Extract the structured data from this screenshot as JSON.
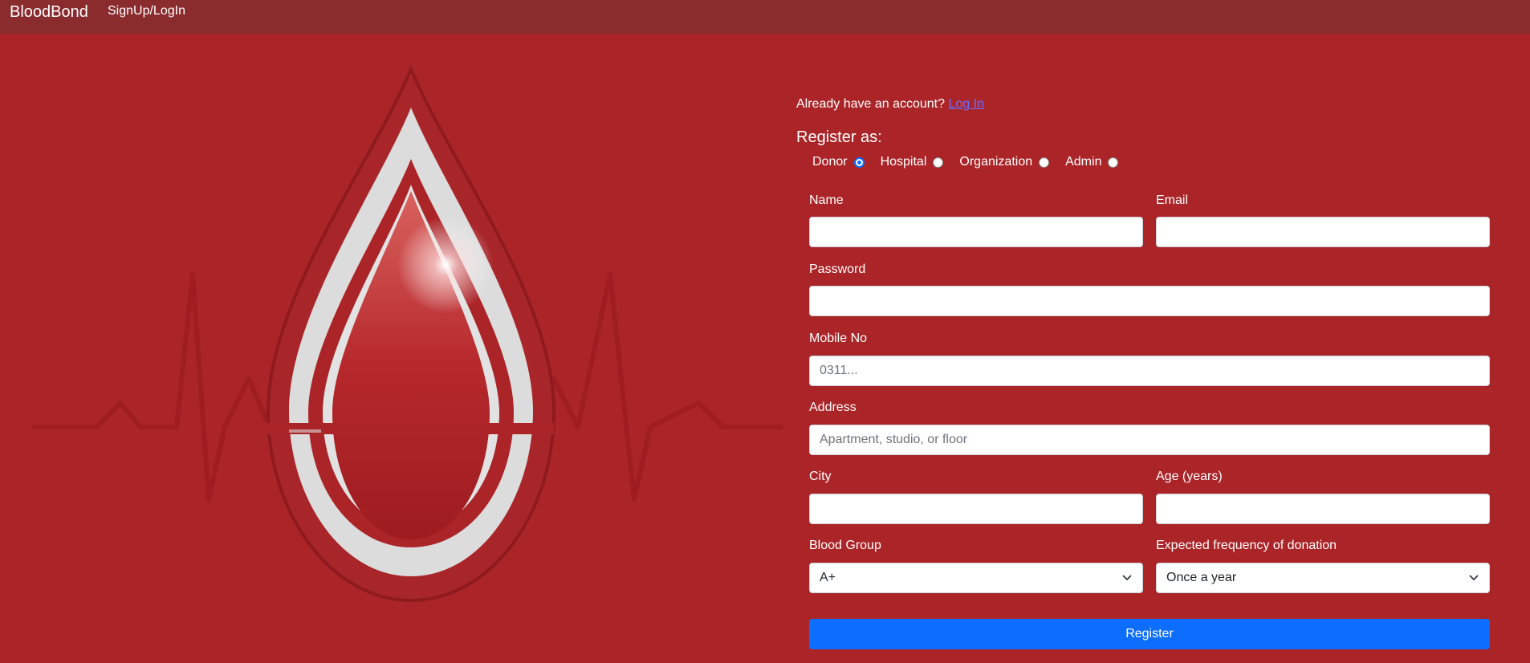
{
  "nav": {
    "brand": "BloodBond",
    "link": "SignUp/LogIn"
  },
  "form": {
    "already_text": "Already have an account?",
    "login_link": "Log In",
    "register_as": "Register as:",
    "roles": [
      "Donor",
      "Hospital",
      "Organization",
      "Admin"
    ],
    "selected_role": "Donor",
    "name_label": "Name",
    "email_label": "Email",
    "password_label": "Password",
    "mobile_label": "Mobile No",
    "mobile_placeholder": "0311...",
    "address_label": "Address",
    "address_placeholder": "Apartment, studio, or floor",
    "city_label": "City",
    "age_label": "Age (years)",
    "blood_group_label": "Blood Group",
    "blood_group_value": "A+",
    "frequency_label": "Expected frequency of donation",
    "frequency_value": "Once a year",
    "register_button": "Register"
  },
  "colors": {
    "background": "#ab2428",
    "navbar": "#8a2b2e",
    "accent": "#0d6efd"
  }
}
